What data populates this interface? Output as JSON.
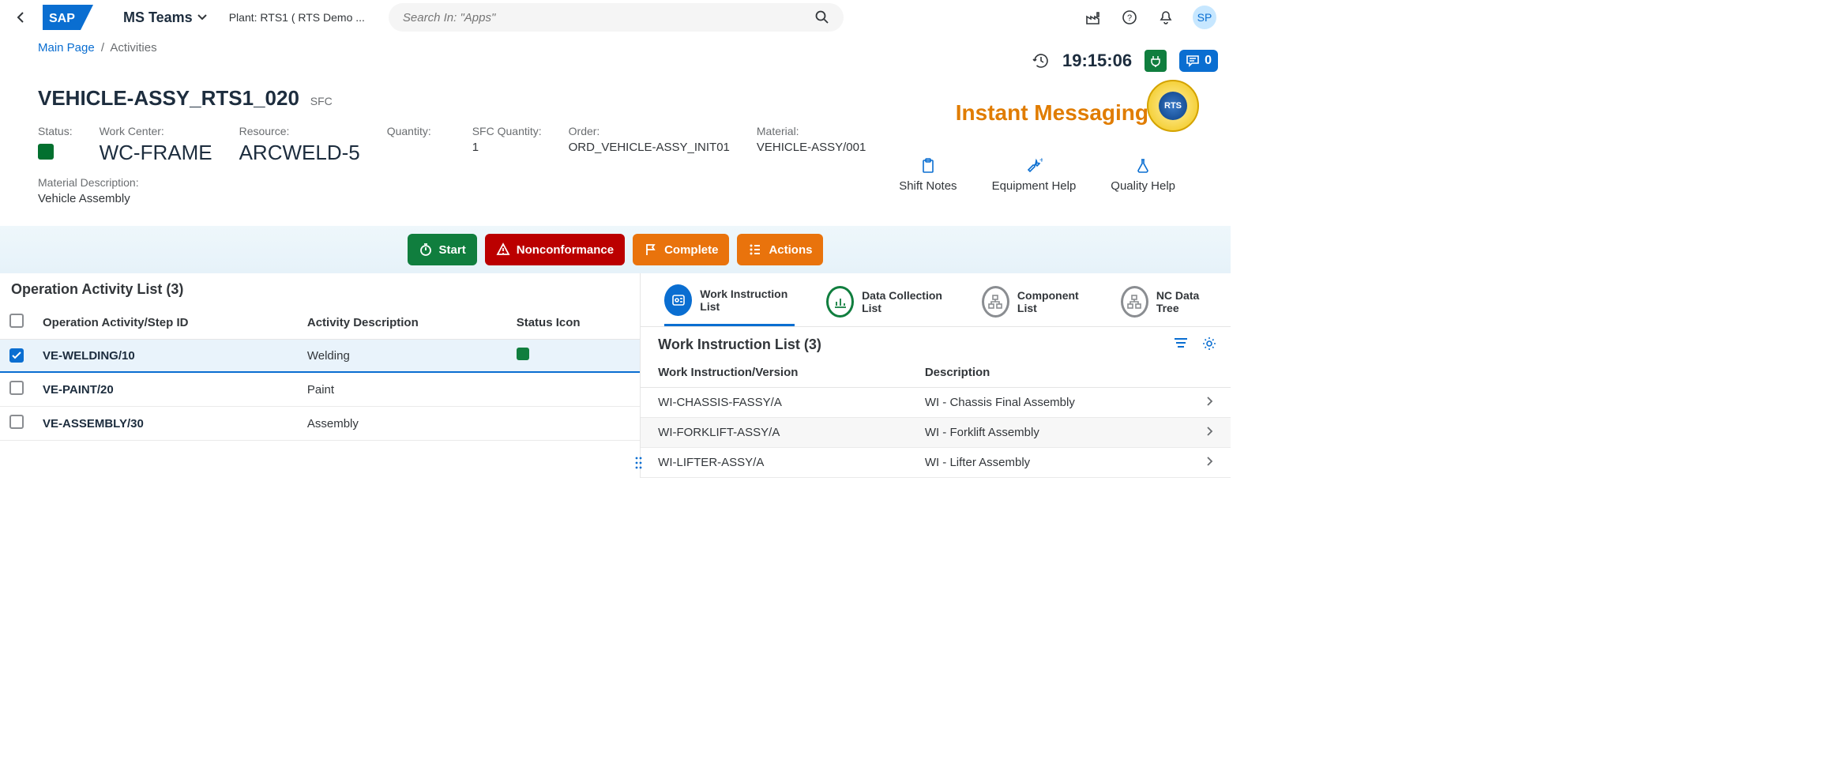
{
  "header": {
    "app": "MS Teams",
    "plant_prefix": "Plant: ",
    "plant": "RTS1 ( RTS Demo ...",
    "search_placeholder": "Search In: \"Apps\"",
    "avatar_initials": "SP"
  },
  "breadcrumb": {
    "main": "Main Page",
    "current": "Activities"
  },
  "clock": "19:15:06",
  "comment_badge": "0",
  "title": "VEHICLE-ASSY_RTS1_020",
  "title_suffix": "SFC",
  "fields": {
    "status_label": "Status:",
    "work_center_label": "Work Center:",
    "work_center_value": "WC-FRAME",
    "resource_label": "Resource:",
    "resource_value": "ARCWELD-5",
    "quantity_label": "Quantity:",
    "sfc_qty_label": "SFC Quantity:",
    "sfc_qty_value": "1",
    "order_label": "Order:",
    "order_value": "ORD_VEHICLE-ASSY_INIT01",
    "material_label": "Material:",
    "material_value": "VEHICLE-ASSY/001",
    "material_desc_label": "Material Description:",
    "material_desc_value": "Vehicle Assembly"
  },
  "instant_messaging": "Instant Messaging",
  "help_links": {
    "shift_notes": "Shift Notes",
    "equipment_help": "Equipment Help",
    "quality_help": "Quality Help"
  },
  "actions": {
    "start": "Start",
    "nc": "Nonconformance",
    "complete": "Complete",
    "actions": "Actions"
  },
  "left": {
    "heading": "Operation Activity List (3)",
    "col_step": "Operation Activity/Step ID",
    "col_desc": "Activity Description",
    "col_status": "Status Icon",
    "rows": [
      {
        "step": "VE-WELDING/10",
        "desc": "Welding",
        "selected": true,
        "status": true
      },
      {
        "step": "VE-PAINT/20",
        "desc": "Paint",
        "selected": false,
        "status": false
      },
      {
        "step": "VE-ASSEMBLY/30",
        "desc": "Assembly",
        "selected": false,
        "status": false
      }
    ]
  },
  "right": {
    "tabs": {
      "wi": "Work Instruction List",
      "dc": "Data Collection List",
      "comp": "Component List",
      "nc": "NC Data Tree"
    },
    "wi_heading": "Work Instruction List (3)",
    "col_version": "Work Instruction/Version",
    "col_desc": "Description",
    "rows": [
      {
        "version": "WI-CHASSIS-FASSY/A",
        "desc": "WI - Chassis Final Assembly"
      },
      {
        "version": "WI-FORKLIFT-ASSY/A",
        "desc": "WI - Forklift Assembly"
      },
      {
        "version": "WI-LIFTER-ASSY/A",
        "desc": "WI - Lifter Assembly"
      }
    ]
  }
}
